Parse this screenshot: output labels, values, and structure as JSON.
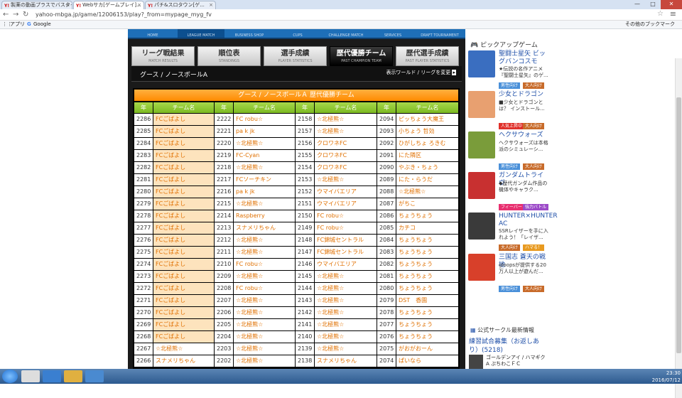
{
  "browser": {
    "tabs": [
      {
        "fav": "Y!",
        "label": "製薬の動画プラスでバスタイム・..."
      },
      {
        "fav": "Y!",
        "label": "Webサカ[ゲームプレイ]..."
      },
      {
        "fav": "Y!",
        "label": "パチ&スロタウン[ゲ..."
      }
    ],
    "window_buttons": [
      "—",
      "□",
      "✕"
    ],
    "url": "yahoo-mbga.jp/game/12006153/play?_from=mypage_myg_fv",
    "bookmarks": {
      "apps": "アプリ",
      "google": "Google",
      "other": "その他のブックマーク"
    }
  },
  "topnav": [
    "HOME",
    "LEAGUE MATCH",
    "BUSINESS SHOP",
    "CUPS",
    "CHALLENGE MATCH",
    "SERVICES",
    "DRAFT TOURNAMENT"
  ],
  "subtabs": [
    {
      "label": "リーグ戦結果",
      "sub": "MATCH RESULTS"
    },
    {
      "label": "順位表",
      "sub": "STANDINGS"
    },
    {
      "label": "選手成績",
      "sub": "PLAYER STATISTICS"
    },
    {
      "label": "歴代優勝チーム",
      "sub": "PAST CHAMPION TEAM"
    },
    {
      "label": "歴代選手成績",
      "sub": "PAST PLAYER STATISTICS"
    }
  ],
  "crumb": "グース / ノースボールA",
  "change_world": "表示ワールド / リーグを変更",
  "table": {
    "title": "グース / ノースボールＡ 歴代優勝チーム",
    "headers": [
      "年",
      "チーム名",
      "年",
      "チーム名",
      "年",
      "チーム名",
      "年",
      "チーム名"
    ],
    "rows": [
      [
        "2286",
        "FCごばよし",
        "2222",
        "FC robu☆",
        "2158",
        "☆北極熊☆",
        "2094",
        "ピッちょう大魔王"
      ],
      [
        "2285",
        "FCごばよし",
        "2221",
        "pa k jk",
        "2157",
        "☆北極熊☆",
        "2093",
        "小ちょう 哲効"
      ],
      [
        "2284",
        "FCごばよし",
        "2220",
        "☆北極熊☆",
        "2156",
        "クロワネFC",
        "2092",
        "ひがしちょ ろきむ"
      ],
      [
        "2283",
        "FCごばよし",
        "2219",
        "FC-Cyan",
        "2155",
        "クロワネFC",
        "2091",
        "にた隣区"
      ],
      [
        "2282",
        "FCごばよし",
        "2218",
        "☆北極熊☆",
        "2154",
        "クロワネFC",
        "2090",
        "やぶき・ちょう"
      ],
      [
        "2281",
        "FCごばよし",
        "2217",
        "FCソーチキン",
        "2153",
        "☆北極熊☆",
        "2089",
        "にた・らうだ"
      ],
      [
        "2280",
        "FCごばよし",
        "2216",
        "pa k jk",
        "2152",
        "ウマイバエリア",
        "2088",
        "☆北極熊☆"
      ],
      [
        "2279",
        "FCごばよし",
        "2215",
        "☆北極熊☆",
        "2151",
        "ウマイバエリア",
        "2087",
        "がちこ"
      ],
      [
        "2278",
        "FCごばよし",
        "2214",
        "Raspberry",
        "2150",
        "FC robu☆",
        "2086",
        "ちょうちょう"
      ],
      [
        "2277",
        "FCごばよし",
        "2213",
        "スナメリちゃん",
        "2149",
        "FC robu☆",
        "2085",
        "カチコ"
      ],
      [
        "2276",
        "FCごばよし",
        "2212",
        "☆北極熊☆",
        "2148",
        "FC錦城セントラル",
        "2084",
        "ちょうちょう"
      ],
      [
        "2275",
        "FCごばよし",
        "2211",
        "☆北極熊☆",
        "2147",
        "FC錦城セントラル",
        "2083",
        "ちょうちょう"
      ],
      [
        "2274",
        "FCごばよし",
        "2210",
        "FC robu☆",
        "2146",
        "ウマイバエリア",
        "2082",
        "ちょうちょう"
      ],
      [
        "2273",
        "FCごばよし",
        "2209",
        "☆北極熊☆",
        "2145",
        "☆北極熊☆",
        "2081",
        "ちょうちょう"
      ],
      [
        "2272",
        "FCごばよし",
        "2208",
        "FC robu☆",
        "2144",
        "☆北極熊☆",
        "2080",
        "ちょうちょう"
      ],
      [
        "2271",
        "FCごばよし",
        "2207",
        "☆北極熊☆",
        "2143",
        "☆北極熊☆",
        "2079",
        "DST　香園"
      ],
      [
        "2270",
        "FCごばよし",
        "2206",
        "☆北極熊☆",
        "2142",
        "☆北極熊☆",
        "2078",
        "ちょうちょう"
      ],
      [
        "2269",
        "FCごばよし",
        "2205",
        "☆北極熊☆",
        "2141",
        "☆北極熊☆",
        "2077",
        "ちょうちょう"
      ],
      [
        "2268",
        "FCごばよし",
        "2204",
        "☆北極熊☆",
        "2140",
        "☆北極熊☆",
        "2076",
        "ちょうちょう"
      ],
      [
        "2267",
        "☆北極熊☆",
        "2203",
        "☆北極熊☆",
        "2139",
        "☆北極熊☆",
        "2075",
        "がおがおーん"
      ],
      [
        "2266",
        "スナメリちゃん",
        "2202",
        "☆北極熊☆",
        "2138",
        "スナメリちゃん",
        "2074",
        "ぱいなら"
      ]
    ]
  },
  "sidebar": {
    "heading": "ピックアップゲーム",
    "games": [
      {
        "title": "聖闘士星矢 ビッグバンコスモ",
        "desc": "★伝説の名作アニメ『聖闘士星矢』のゲ...",
        "tags": [
          "男性向け",
          "大人向け"
        ],
        "tagcolors": [
          "#4a90d9",
          "#c86b2a"
        ],
        "thumb": "#3a6ec0"
      },
      {
        "title": "少女とドラゴン",
        "desc": "■少女とドラゴンとは？ インストール...",
        "tags": [
          "人気上昇中",
          "大人向け"
        ],
        "tagcolors": [
          "#e0302a",
          "#c86b2a"
        ],
        "thumb": "#e8a070"
      },
      {
        "title": "ヘクサウォーズ",
        "desc": "ヘクサウォーズは本格派のシミュレーシ...",
        "tags": [
          "男性向け",
          "大人向け"
        ],
        "tagcolors": [
          "#4a90d9",
          "#c86b2a"
        ],
        "thumb": "#7a9c3a"
      },
      {
        "title": "ガンダムトライヴ",
        "desc": "◆歴代ガンダム作品の機体やキャラク...",
        "tags": [
          "フィーバー",
          "強力バトル"
        ],
        "tagcolors": [
          "#e83070",
          "#9c4ac8"
        ],
        "thumb": "#c83030"
      },
      {
        "title": "HUNTER×HUNTER　AC",
        "desc": "SSRレイザーを手に入れよう！「レイザ...",
        "tags": [
          "大人向け",
          "ハマる！"
        ],
        "tagcolors": [
          "#c86b2a",
          "#e89a20"
        ],
        "thumb": "#3a3a3a"
      },
      {
        "title": "三国志 蒼天の戦地",
        "desc": "gloopsが提供する20万人以上が遊んだ...",
        "tags": [
          "男性向け",
          "大人向け"
        ],
        "tagcolors": [
          "#4a90d9",
          "#c86b2a"
        ],
        "thumb": "#d8402a"
      }
    ],
    "circle_heading": "公式サークル最新情報",
    "circle_item": "練習試合募集（お返しあり）(5218)",
    "circle_sub": "ゴールデンアイ / ハマギクA ぷちわこＦＣ"
  },
  "taskbar": {
    "time": "23:30",
    "date": "2016/07/12"
  }
}
